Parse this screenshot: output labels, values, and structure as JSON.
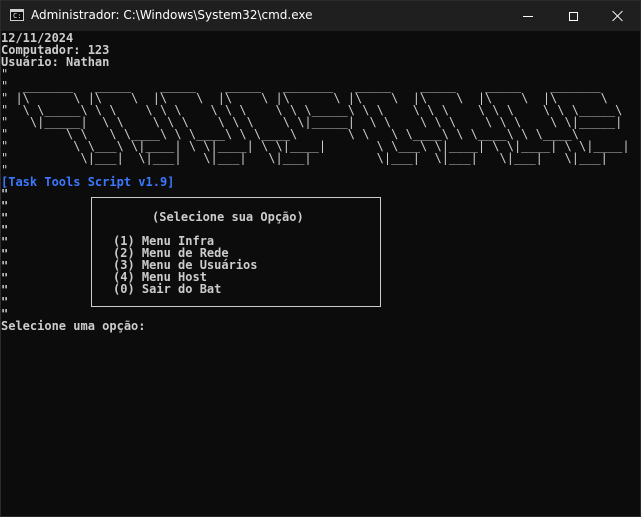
{
  "window": {
    "title": "Administrador: C:\\Windows\\System32\\cmd.exe",
    "icon": "cmd-icon",
    "controls": [
      "minimize-icon",
      "maximize-icon",
      "close-icon"
    ]
  },
  "console": {
    "date_line": "12/11/2024",
    "computer_line": "Computador: 123",
    "user_line": "Usuário: Nathan",
    "ascii_banner": [
      "\"",
      "\"  _______   _____    _____    _____   _______   _____    _____    _____    _______",
      "\" |\\      \\ |\\    \\  |\\    \\  |\\    \\ |\\      \\ |\\    \\  |\\    \\  |\\    \\  |\\      \\",
      "\"  \\ \\_____\\ \\ \\    \\ \\ \\    \\ \\ \\    \\ \\ \\_____\\ \\ \\    \\ \\ \\    \\ \\ \\    \\ \\ \\_____\\",
      "\"   \\|_____|  \\ \\    \\ \\ \\    \\ \\ \\    \\ \\|_____|  \\ \\    \\ \\ \\    \\ \\ \\    \\ \\|_____|",
      "\"        \\ \\   \\ \\____\\ \\ \\____\\ \\ \\____\\       \\ \\   \\ \\____\\ \\ \\____\\ \\ \\____\\",
      "\"         \\ \\___\\ \\|____| \\ \\|____| \\ \\|____|       \\ \\___\\ \\|____| \\ \\|____| \\ \\|____|",
      "\"          \\|___|  \\|___|   \\|___|   \\|___|         \\|___|  \\|___|   \\|___|   \\|___|",
      "\""
    ],
    "script_title": "[Task Tools Script v1.9]",
    "menu_lead_lines": [
      "\"",
      "\"",
      "\"",
      "\"",
      "\"",
      "\"",
      "\"",
      "\"",
      "\"",
      "\"",
      "\""
    ],
    "menu_header": "(Selecione sua Opção)",
    "menu_options": [
      "(1) Menu Infra",
      "(2) Menu de Rede",
      "(3) Menu de Usuários",
      "(4) Menu Host",
      "(0) Sair do Bat"
    ],
    "prompt": "Selecione uma opção:"
  },
  "colors": {
    "background": "#0c0c0c",
    "text": "#cccccc",
    "accent_blue": "#3b78ff",
    "titlebar": "#1f1f1f"
  }
}
